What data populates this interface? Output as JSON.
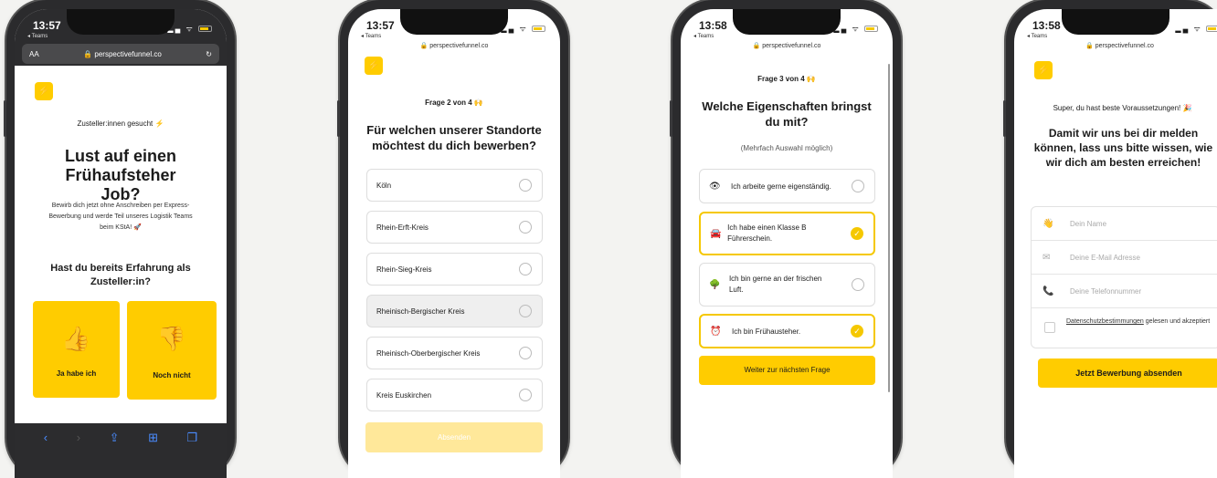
{
  "phone1": {
    "time": "13:57",
    "back": "◂ Teams",
    "url": "perspectivefunnel.co",
    "text_size": "AA",
    "tagline": "Zusteller:innen gesucht ⚡",
    "headline": "Lust auf einen Frühaufsteher Job?",
    "body": "Bewirb dich jetzt ohne Anschreiben per Express-Bewerbung und werde Teil unseres Logistik Teams beim KStA! 🚀",
    "question": "Hast du bereits Erfahrung als Zusteller:in?",
    "yes_label": "Ja habe ich",
    "no_label": "Noch nicht"
  },
  "phone2": {
    "time": "13:57",
    "back": "◂ Teams",
    "url": "perspectivefunnel.co",
    "progress": "Frage 2 von 4 🙌",
    "question": "Für welchen unserer Standorte möchtest du dich bewerben?",
    "options": [
      "Köln",
      "Rhein-Erft-Kreis",
      "Rhein-Sieg-Kreis",
      "Rheinisch-Bergischer Kreis",
      "Rheinisch-Oberbergischer Kreis",
      "Kreis Euskirchen"
    ],
    "submit": "Absenden"
  },
  "phone3": {
    "time": "13:58",
    "back": "◂ Teams",
    "url": "perspectivefunnel.co",
    "progress": "Frage 3 von 4 🙌",
    "question": "Welche Eigenschaften bringst du mit?",
    "hint": "(Mehrfach Auswahl möglich)",
    "options": [
      {
        "icon": "👁",
        "label": "Ich arbeite gerne eigenständig.",
        "checked": false
      },
      {
        "icon": "🚘",
        "label": "Ich habe einen Klasse B Führerschein.",
        "checked": true
      },
      {
        "icon": "🌳",
        "label": "Ich bin gerne an der frischen Luft.",
        "checked": false
      },
      {
        "icon": "⏰",
        "label": "Ich bin Frühausteher.",
        "checked": true
      }
    ],
    "next": "Weiter zur nächsten Frage"
  },
  "phone4": {
    "time": "13:58",
    "back": "◂ Teams",
    "url": "perspectivefunnel.co",
    "success": "Super, du hast beste Voraussetzungen! 🎉",
    "headline": "Damit wir uns bei dir melden können, lass uns bitte wissen, wie wir dich am besten erreichen!",
    "name_placeholder": "Dein Name",
    "email_placeholder": "Deine E-Mail Adresse",
    "phone_placeholder": "Deine Telefonnummer",
    "privacy_link": "Datenschutzbestimmungen",
    "privacy_rest": " gelesen und akzeptiert",
    "submit": "Jetzt Bewerbung absenden"
  },
  "colors": {
    "accent": "#ffcc00",
    "selected_border": "#f5c800"
  }
}
